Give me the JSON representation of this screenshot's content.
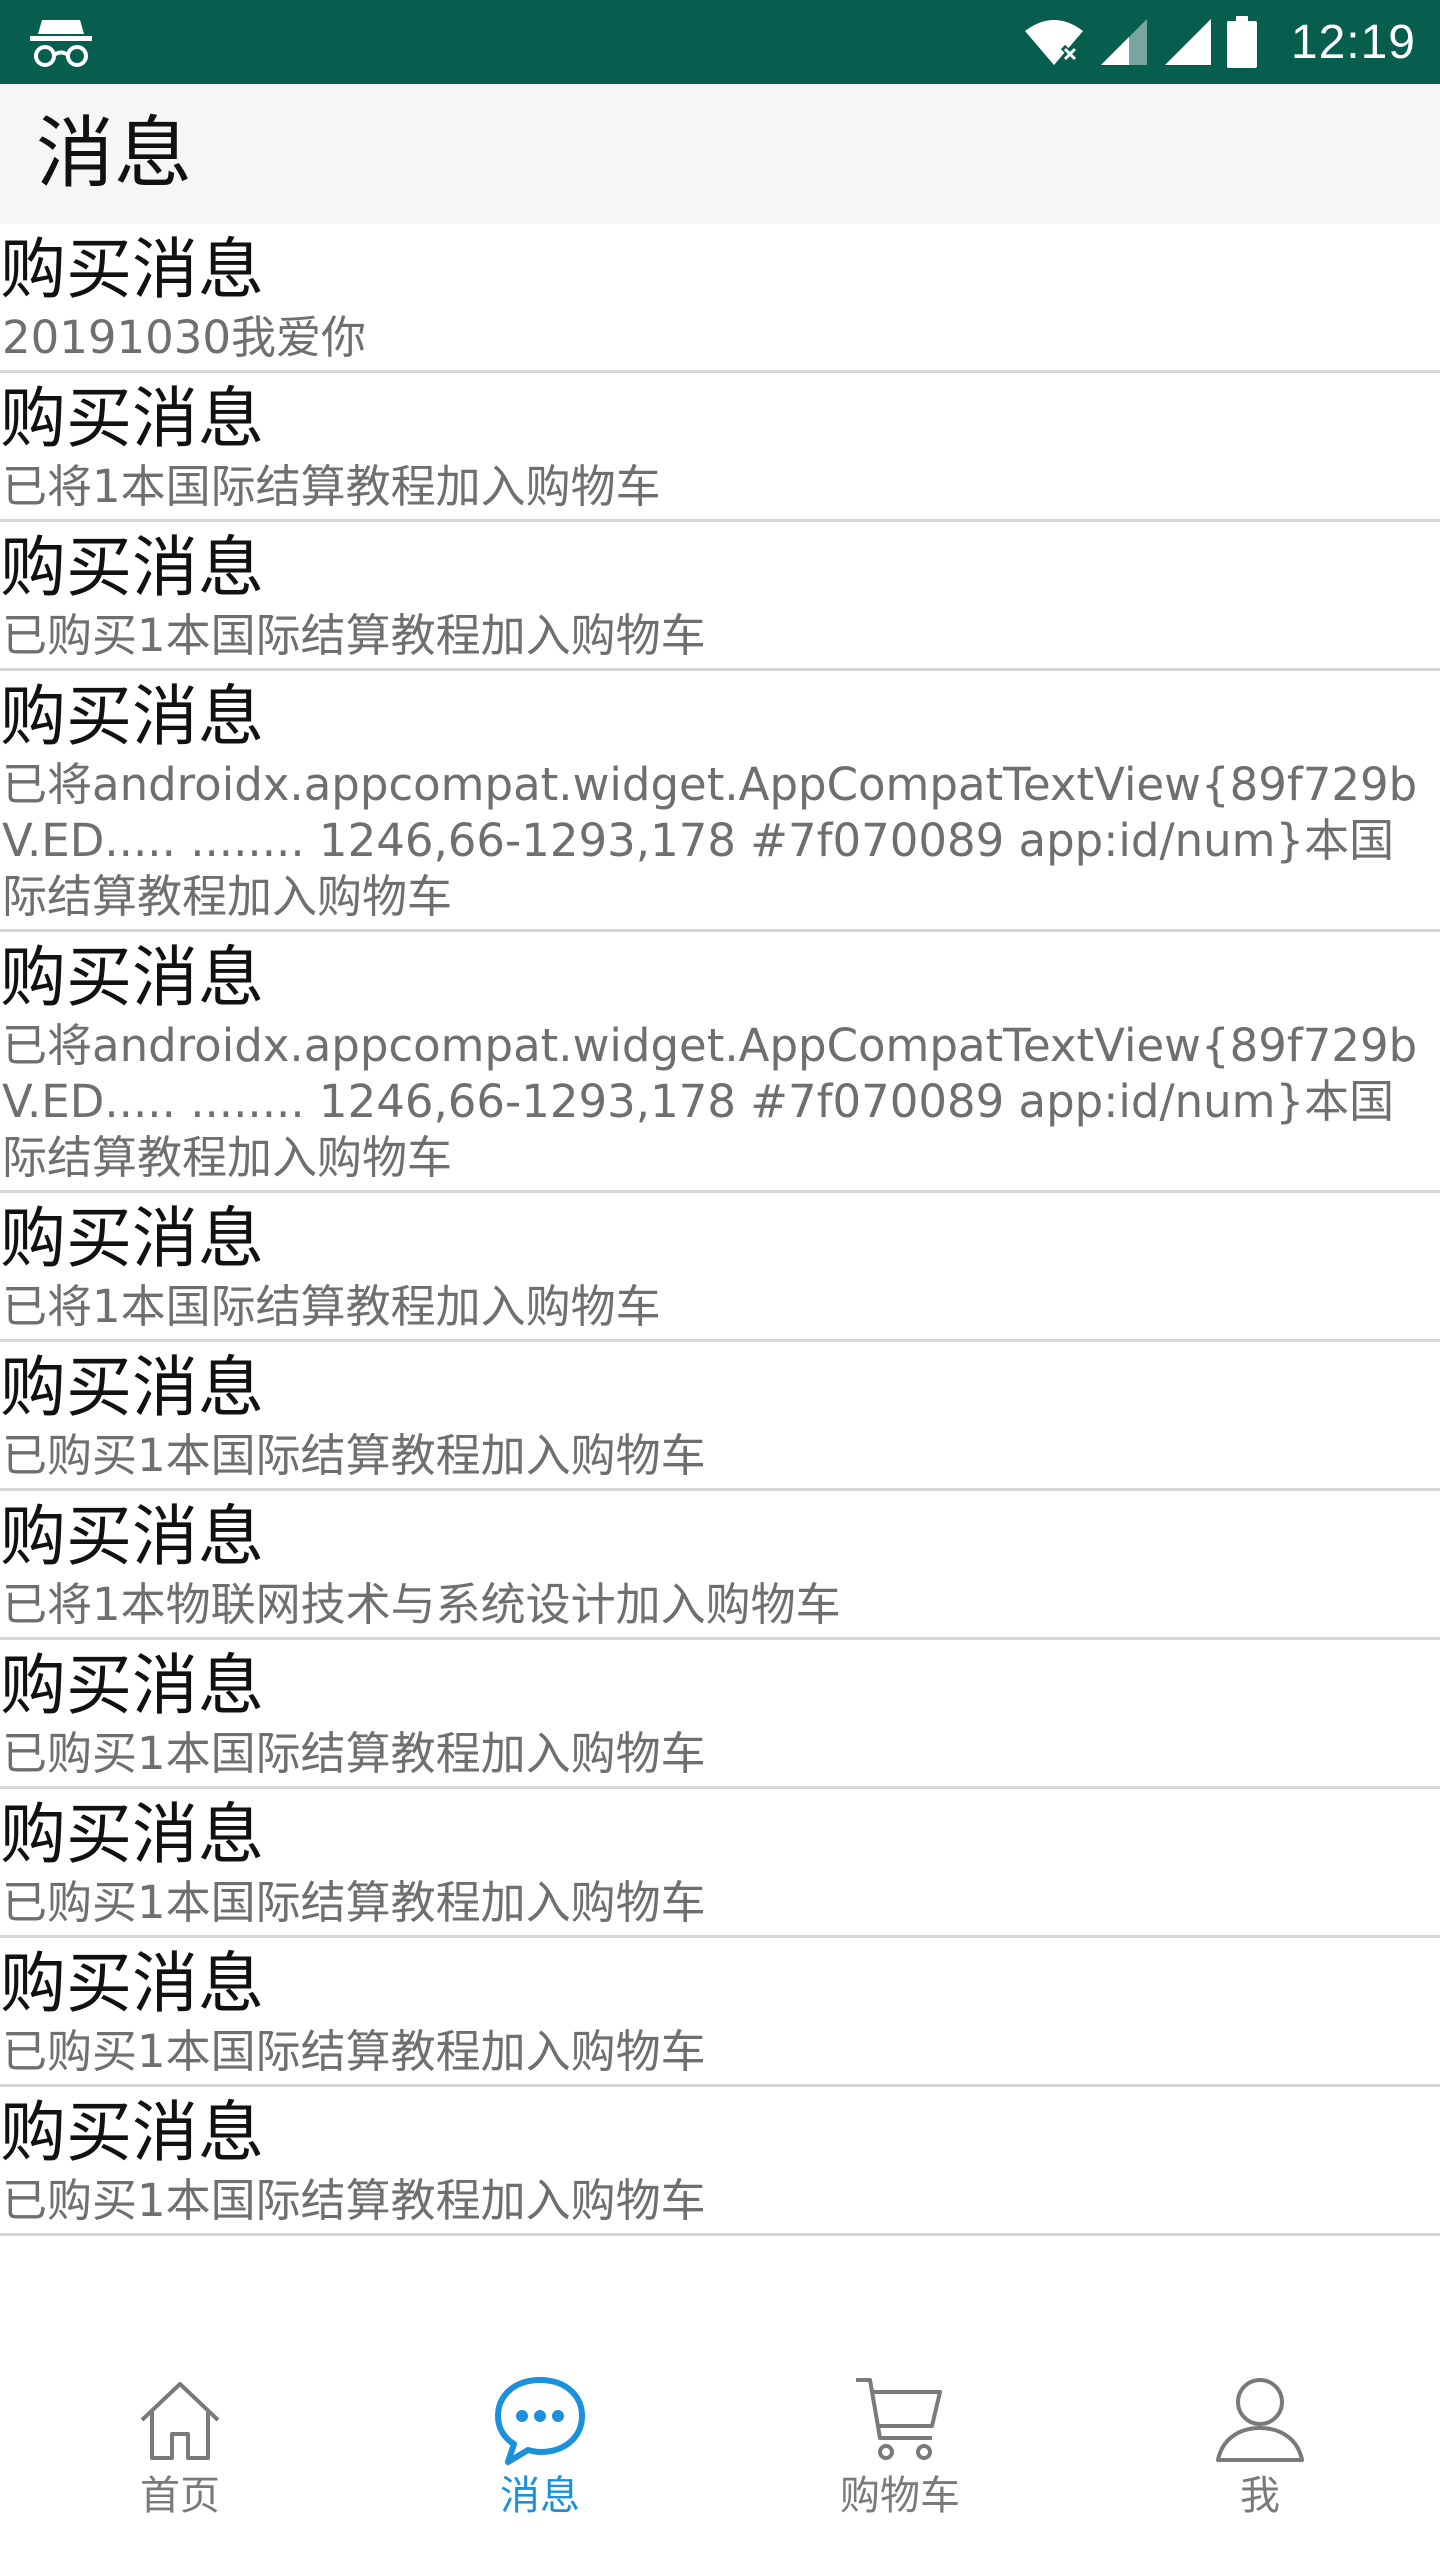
{
  "status_bar": {
    "time": "12:19",
    "left_icon": "incognito-icon",
    "icons": [
      "wifi-icon",
      "signal-icon",
      "signal-icon",
      "battery-icon"
    ],
    "background_color": "#075e4f"
  },
  "app_bar": {
    "title": "消息"
  },
  "messages": [
    {
      "title": "购买消息",
      "detail": "20191030我爱你"
    },
    {
      "title": "购买消息",
      "detail": "已将1本国际结算教程加入购物车"
    },
    {
      "title": "购买消息",
      "detail": "已购买1本国际结算教程加入购物车"
    },
    {
      "title": "购买消息",
      "detail": "已将androidx.appcompat.widget.AppCompatTextView{89f729b V.ED..... ........ 1246,66-1293,178 #7f070089 app:id/num}本国际结算教程加入购物车"
    },
    {
      "title": "购买消息",
      "detail": "已将androidx.appcompat.widget.AppCompatTextView{89f729b V.ED..... ........ 1246,66-1293,178 #7f070089 app:id/num}本国际结算教程加入购物车"
    },
    {
      "title": "购买消息",
      "detail": "已将1本国际结算教程加入购物车"
    },
    {
      "title": "购买消息",
      "detail": "已购买1本国际结算教程加入购物车"
    },
    {
      "title": "购买消息",
      "detail": "已将1本物联网技术与系统设计加入购物车"
    },
    {
      "title": "购买消息",
      "detail": "已购买1本国际结算教程加入购物车"
    },
    {
      "title": "购买消息",
      "detail": "已购买1本国际结算教程加入购物车"
    },
    {
      "title": "购买消息",
      "detail": "已购买1本国际结算教程加入购物车"
    },
    {
      "title": "购买消息",
      "detail": "已购买1本国际结算教程加入购物车"
    }
  ],
  "bottom_nav": {
    "items": [
      {
        "label": "首页",
        "icon": "home-icon",
        "active": false
      },
      {
        "label": "消息",
        "icon": "chat-icon",
        "active": true
      },
      {
        "label": "购物车",
        "icon": "cart-icon",
        "active": false
      },
      {
        "label": "我",
        "icon": "person-icon",
        "active": false
      }
    ],
    "active_color": "#1a91da",
    "inactive_color": "#7a7a7a"
  }
}
